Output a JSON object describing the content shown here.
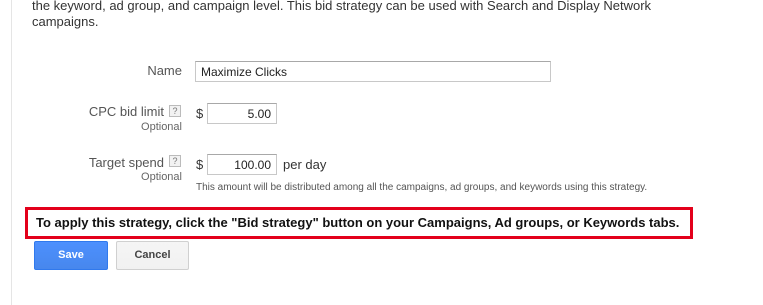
{
  "intro": {
    "line1": "the keyword, ad group, and campaign level. This bid strategy can be used with Search and Display Network",
    "line2": "campaigns."
  },
  "form": {
    "name": {
      "label": "Name",
      "value": "Maximize Clicks"
    },
    "cpc_bid_limit": {
      "label": "CPC bid limit",
      "help": "?",
      "optional": "Optional",
      "currency": "$",
      "value": "5.00"
    },
    "target_spend": {
      "label": "Target spend",
      "help": "?",
      "optional": "Optional",
      "currency": "$",
      "value": "100.00",
      "suffix": "per day",
      "hint": "This amount will be distributed among all the campaigns, ad groups, and keywords using this strategy."
    }
  },
  "notice": "To apply this strategy, click the \"Bid strategy\" button on your Campaigns, Ad groups, or Keywords tabs.",
  "buttons": {
    "save": "Save",
    "cancel": "Cancel"
  },
  "colors": {
    "notice_border": "#e3001b",
    "save_button": "#4d90fe"
  },
  "icons": {
    "help": "question-mark-icon"
  }
}
